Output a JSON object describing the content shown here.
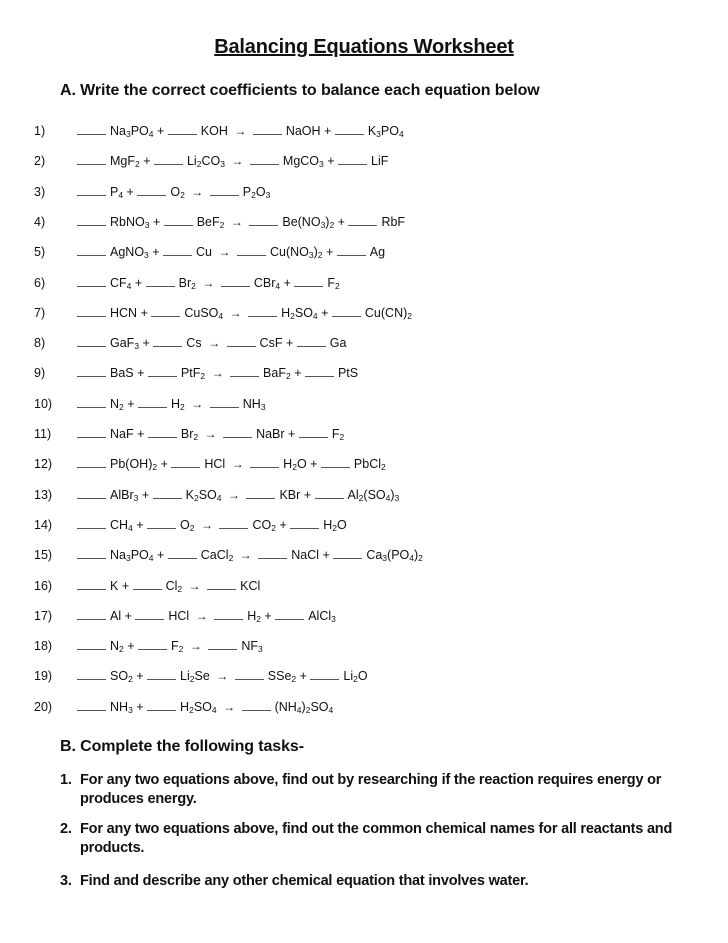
{
  "document": {
    "title": "Balancing Equations Worksheet",
    "section_a": {
      "heading": "A. Write the correct coefficients to balance each equation below",
      "equations": [
        {
          "num": "1)",
          "reactants": [
            [
              "Na",
              {
                "s": "3"
              },
              "PO",
              {
                "s": "4"
              }
            ],
            [
              "KOH"
            ]
          ],
          "products": [
            [
              "NaOH"
            ],
            [
              "K",
              {
                "s": "3"
              },
              "PO",
              {
                "s": "4"
              }
            ]
          ]
        },
        {
          "num": "2)",
          "reactants": [
            [
              "MgF",
              {
                "s": "2"
              }
            ],
            [
              "Li",
              {
                "s": "2"
              },
              "CO",
              {
                "s": "3"
              }
            ]
          ],
          "products": [
            [
              "MgCO",
              {
                "s": "3"
              }
            ],
            [
              "LiF"
            ]
          ]
        },
        {
          "num": "3)",
          "reactants": [
            [
              "P",
              {
                "s": "4"
              }
            ],
            [
              "O",
              {
                "s": "2"
              }
            ]
          ],
          "products": [
            [
              "P",
              {
                "s": "2"
              },
              "O",
              {
                "s": "3"
              }
            ]
          ]
        },
        {
          "num": "4)",
          "reactants": [
            [
              "RbNO",
              {
                "s": "3"
              }
            ],
            [
              "BeF",
              {
                "s": "2"
              }
            ]
          ],
          "products": [
            [
              "Be(NO",
              {
                "s": "3"
              },
              ")",
              {
                "s": "2"
              }
            ],
            [
              "RbF"
            ]
          ]
        },
        {
          "num": "5)",
          "reactants": [
            [
              "AgNO",
              {
                "s": "3"
              }
            ],
            [
              "Cu"
            ]
          ],
          "products": [
            [
              "Cu(NO",
              {
                "s": "3"
              },
              ")",
              {
                "s": "2"
              }
            ],
            [
              "Ag"
            ]
          ]
        },
        {
          "num": "6)",
          "reactants": [
            [
              "CF",
              {
                "s": "4"
              }
            ],
            [
              "Br",
              {
                "s": "2"
              }
            ]
          ],
          "products": [
            [
              "CBr",
              {
                "s": "4"
              }
            ],
            [
              "F",
              {
                "s": "2"
              }
            ]
          ]
        },
        {
          "num": "7)",
          "reactants": [
            [
              "HCN"
            ],
            [
              "CuSO",
              {
                "s": "4"
              }
            ]
          ],
          "products": [
            [
              "H",
              {
                "s": "2"
              },
              "SO",
              {
                "s": "4"
              }
            ],
            [
              "Cu(CN)",
              {
                "s": "2"
              }
            ]
          ]
        },
        {
          "num": "8)",
          "reactants": [
            [
              "GaF",
              {
                "s": "3"
              }
            ],
            [
              "Cs"
            ]
          ],
          "products": [
            [
              "CsF"
            ],
            [
              "Ga"
            ]
          ]
        },
        {
          "num": "9)",
          "reactants": [
            [
              "BaS"
            ],
            [
              "PtF",
              {
                "s": "2"
              }
            ]
          ],
          "products": [
            [
              "BaF",
              {
                "s": "2"
              }
            ],
            [
              "PtS"
            ]
          ]
        },
        {
          "num": "10)",
          "reactants": [
            [
              "N",
              {
                "s": "2"
              }
            ],
            [
              "H",
              {
                "s": "2"
              }
            ]
          ],
          "products": [
            [
              "NH",
              {
                "s": "3"
              }
            ]
          ]
        },
        {
          "num": "11)",
          "reactants": [
            [
              "NaF"
            ],
            [
              "Br",
              {
                "s": "2"
              }
            ]
          ],
          "products": [
            [
              "NaBr"
            ],
            [
              "F",
              {
                "s": "2"
              }
            ]
          ]
        },
        {
          "num": "12)",
          "reactants": [
            [
              "Pb(OH)",
              {
                "s": "2"
              }
            ],
            [
              "HCl"
            ]
          ],
          "products": [
            [
              "H",
              {
                "s": "2"
              },
              "O"
            ],
            [
              "PbCl",
              {
                "s": "2"
              }
            ]
          ]
        },
        {
          "num": "13)",
          "reactants": [
            [
              "AlBr",
              {
                "s": "3"
              }
            ],
            [
              "K",
              {
                "s": "2"
              },
              "SO",
              {
                "s": "4"
              }
            ]
          ],
          "products": [
            [
              "KBr"
            ],
            [
              "Al",
              {
                "s": "2"
              },
              "(SO",
              {
                "s": "4"
              },
              ")",
              {
                "s": "3"
              }
            ]
          ]
        },
        {
          "num": "14)",
          "reactants": [
            [
              "CH",
              {
                "s": "4"
              }
            ],
            [
              "O",
              {
                "s": "2"
              }
            ]
          ],
          "products": [
            [
              "CO",
              {
                "s": "2"
              }
            ],
            [
              "H",
              {
                "s": "2"
              },
              "O"
            ]
          ]
        },
        {
          "num": "15)",
          "reactants": [
            [
              "Na",
              {
                "s": "3"
              },
              "PO",
              {
                "s": "4"
              }
            ],
            [
              "CaCl",
              {
                "s": "2"
              }
            ]
          ],
          "products": [
            [
              "NaCl"
            ],
            [
              "Ca",
              {
                "s": "3"
              },
              "(PO",
              {
                "s": "4"
              },
              ")",
              {
                "s": "2"
              }
            ]
          ]
        },
        {
          "num": "16)",
          "reactants": [
            [
              "K"
            ],
            [
              "Cl",
              {
                "s": "2"
              }
            ]
          ],
          "products": [
            [
              "KCl"
            ]
          ]
        },
        {
          "num": "17)",
          "reactants": [
            [
              "Al"
            ],
            [
              "HCl"
            ]
          ],
          "products": [
            [
              "H",
              {
                "s": "2"
              }
            ],
            [
              "AlCl",
              {
                "s": "3"
              }
            ]
          ]
        },
        {
          "num": "18)",
          "reactants": [
            [
              "N",
              {
                "s": "2"
              }
            ],
            [
              "F",
              {
                "s": "2"
              }
            ]
          ],
          "products": [
            [
              "NF",
              {
                "s": "3"
              }
            ]
          ]
        },
        {
          "num": "19)",
          "reactants": [
            [
              "SO",
              {
                "s": "2"
              }
            ],
            [
              "Li",
              {
                "s": "2"
              },
              "Se"
            ]
          ],
          "products": [
            [
              "SSe",
              {
                "s": "2"
              }
            ],
            [
              "Li",
              {
                "s": "2"
              },
              "O"
            ]
          ]
        },
        {
          "num": "20)",
          "reactants": [
            [
              "NH",
              {
                "s": "3"
              }
            ],
            [
              "H",
              {
                "s": "2"
              },
              "SO",
              {
                "s": "4"
              }
            ]
          ],
          "products": [
            [
              "(NH",
              {
                "s": "4"
              },
              ")",
              {
                "s": "2"
              },
              "SO",
              {
                "s": "4"
              }
            ]
          ]
        }
      ],
      "blank_text": "____",
      "plus": "+",
      "arrow": "→"
    },
    "section_b": {
      "heading": "B. Complete the following tasks-",
      "tasks": [
        {
          "num": "1.",
          "text": "For any two equations above, find out by researching if the reaction requires energy or produces energy."
        },
        {
          "num": "2.",
          "text": "For any two equations above, find out the common chemical names for all reactants and products."
        },
        {
          "num": "3.",
          "text": "Find and describe any other chemical equation that involves water."
        }
      ]
    }
  }
}
